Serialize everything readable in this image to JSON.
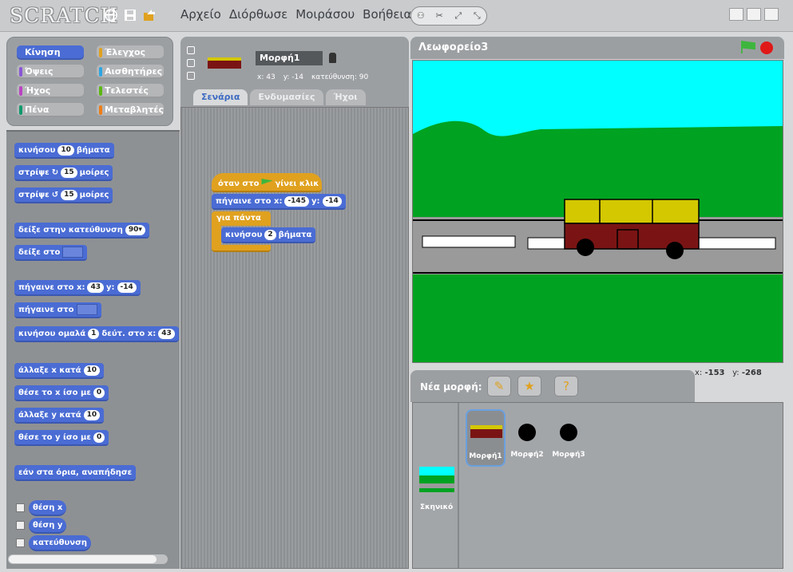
{
  "app": {
    "logo": "SCRATCH",
    "menu": [
      "Αρχείο",
      "Διόρθωσε",
      "Μοιράσου",
      "Βοήθεια"
    ]
  },
  "categories": [
    {
      "label": "Κίνηση",
      "color": "#4a6cd4",
      "active": true
    },
    {
      "label": "Έλεγχος",
      "color": "#e0a11f"
    },
    {
      "label": "Όψεις",
      "color": "#8a55d7"
    },
    {
      "label": "Αισθητήρες",
      "color": "#2ca5e2"
    },
    {
      "label": "Ήχος",
      "color": "#bb42c3"
    },
    {
      "label": "Τελεστές",
      "color": "#5cb712"
    },
    {
      "label": "Πένα",
      "color": "#0e9a6c"
    },
    {
      "label": "Μεταβλητές",
      "color": "#ee7d16"
    }
  ],
  "palette": {
    "move": {
      "pre": "κινήσου",
      "val": "10",
      "post": "βήματα"
    },
    "turn_cw": {
      "pre": "στρίψε",
      "val": "15",
      "post": "μοίρες"
    },
    "turn_ccw": {
      "pre": "στρίψε",
      "val": "15",
      "post": "μοίρες"
    },
    "point_dir": {
      "pre": "δείξε στην κατεύθυνση",
      "val": "90▾"
    },
    "point_towards": {
      "pre": "δείξε στο"
    },
    "goto_xy": {
      "pre": "πήγαινε στο x:",
      "x": "43",
      "ymid": "y:",
      "y": "-14"
    },
    "goto": {
      "pre": "πήγαινε στο"
    },
    "glide": {
      "pre": "κινήσου ομαλά",
      "val": "1",
      "mid": "δεύτ. στο x:",
      "x": "43"
    },
    "change_x": {
      "pre": "άλλαξε x κατά",
      "val": "10"
    },
    "set_x": {
      "pre": "θέσε το x ίσο με",
      "val": "0"
    },
    "change_y": {
      "pre": "άλλαξε y κατά",
      "val": "10"
    },
    "set_y": {
      "pre": "θέσε το y ίσο με",
      "val": "0"
    },
    "bounce": {
      "pre": "εάν στα όρια, αναπήδησε"
    },
    "reporters": [
      "θέση x",
      "θέση y",
      "κατεύθυνση"
    ]
  },
  "sprite": {
    "name": "Μορφή1",
    "x_label": "x:",
    "x": "43",
    "y_label": "y:",
    "y": "-14",
    "dir_label": "κατεύθυνση:",
    "dir": "90"
  },
  "tabs": [
    "Σενάρια",
    "Ενδυμασίες",
    "Ήχοι"
  ],
  "script": {
    "hat_pre": "όταν στο",
    "hat_post": "γίνει κλικ",
    "goto_pre": "πήγαινε στο x:",
    "goto_x": "-145",
    "goto_ymid": "y:",
    "goto_y": "-14",
    "forever": "για πάντα",
    "move_pre": "κινήσου",
    "move_val": "2",
    "move_post": "βήματα"
  },
  "stage": {
    "title": "Λεωφορείο3",
    "colors": {
      "sky": "#00ffff",
      "grass": "#00a321",
      "road": "#9a9a9a",
      "bus_body": "#7a1414",
      "bus_top": "#d4c800"
    }
  },
  "mouse": {
    "x_label": "x:",
    "x": "-153",
    "y_label": "y:",
    "y": "-268"
  },
  "newsprite": {
    "label": "Νέα μορφή:"
  },
  "corral": {
    "stage_label": "Σκηνικό",
    "sprites": [
      "Μορφή1",
      "Μορφή2",
      "Μορφή3"
    ]
  }
}
